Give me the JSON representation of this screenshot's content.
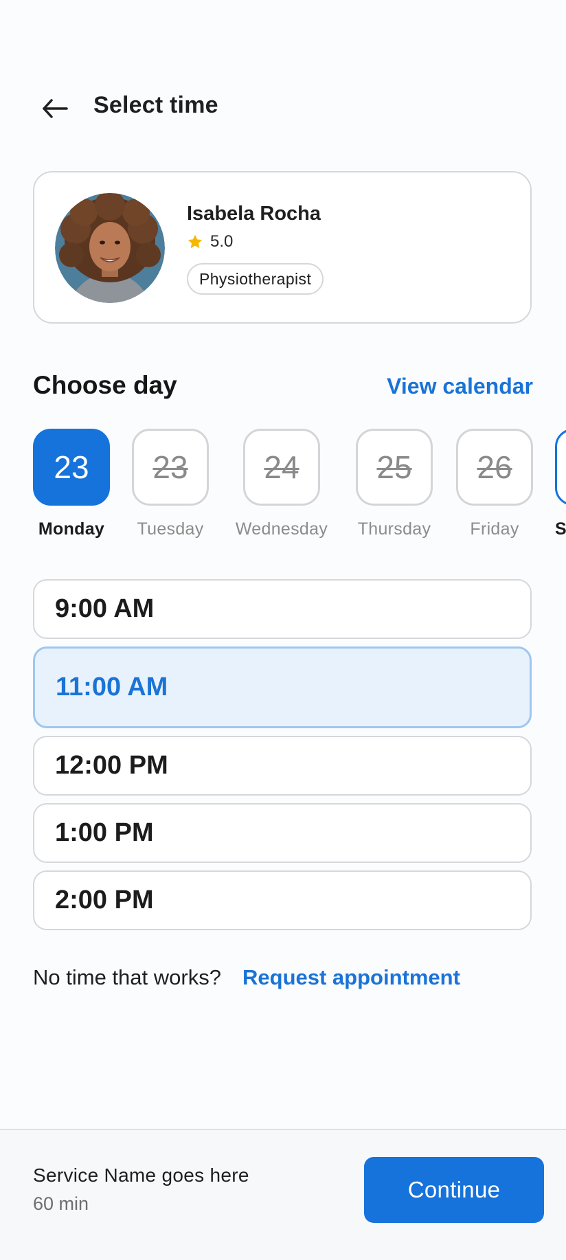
{
  "header": {
    "title": "Select time",
    "back_icon": "arrow-left-icon"
  },
  "provider": {
    "name": "Isabela Rocha",
    "rating": "5.0",
    "role": "Physiotherapist",
    "star_color": "#f5b800"
  },
  "choose_day": {
    "title": "Choose day",
    "view_calendar_label": "View calendar",
    "days": [
      {
        "date": "23",
        "weekday": "Monday",
        "state": "selected"
      },
      {
        "date": "23",
        "weekday": "Tuesday",
        "state": "unavailable"
      },
      {
        "date": "24",
        "weekday": "Wednesday",
        "state": "unavailable"
      },
      {
        "date": "25",
        "weekday": "Thursday",
        "state": "unavailable"
      },
      {
        "date": "26",
        "weekday": "Friday",
        "state": "unavailable"
      },
      {
        "date": "",
        "weekday": "S",
        "state": "available"
      }
    ]
  },
  "time_slots": [
    {
      "label": "9:00 AM",
      "selected": false
    },
    {
      "label": "11:00 AM",
      "selected": true
    },
    {
      "label": "12:00 PM",
      "selected": false
    },
    {
      "label": "1:00 PM",
      "selected": false
    },
    {
      "label": "2:00 PM",
      "selected": false
    }
  ],
  "request": {
    "prompt": "No time that works?",
    "link_label": "Request appointment"
  },
  "footer": {
    "service_name": "Service Name goes here",
    "duration": "60 min",
    "continue_label": "Continue"
  },
  "colors": {
    "accent": "#1673db",
    "selected_slot_bg": "#e8f2fc",
    "selected_slot_border": "#9fc6ef"
  }
}
